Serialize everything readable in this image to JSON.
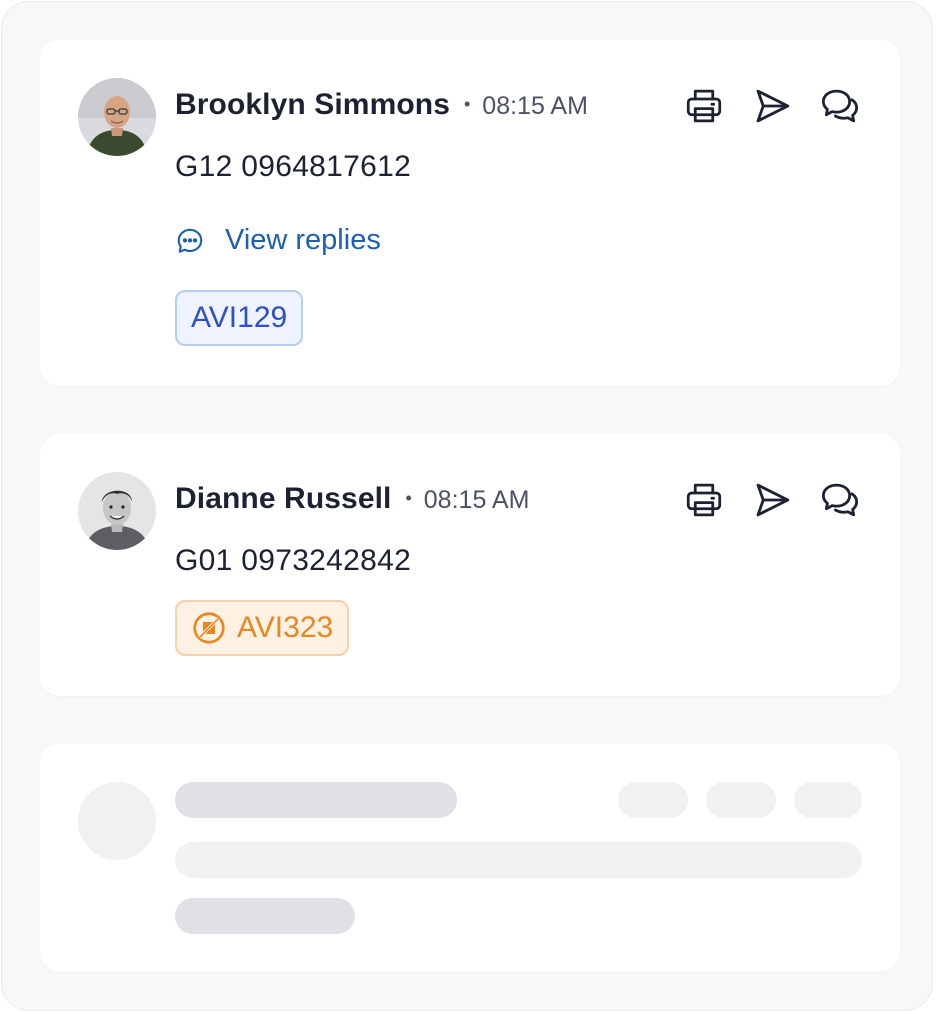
{
  "messages": [
    {
      "author": "Brooklyn Simmons",
      "separator": "•",
      "time": "08:15 AM",
      "code": "G12 0964817612",
      "replies_label": "View replies",
      "badge": "AVI129",
      "badge_color": "#2f4fc8",
      "actions": [
        "printer-icon",
        "send-icon",
        "chat-bubbles-icon"
      ]
    },
    {
      "author": "Dianne Russell",
      "separator": "•",
      "time": "08:15 AM",
      "code": "G01 0973242842",
      "badge": "AVI323",
      "badge_color": "#e8861f",
      "badge_icon": "no-image-icon",
      "actions": [
        "printer-icon",
        "send-icon",
        "chat-bubbles-icon"
      ]
    }
  ],
  "skeleton": {
    "state": "loading"
  },
  "colors": {
    "text_primary": "#1c2232",
    "text_secondary": "#4b5263",
    "link": "#1d5fb3",
    "skeleton_dark": "#dfe1e6",
    "skeleton_light": "#f0f1f3"
  }
}
